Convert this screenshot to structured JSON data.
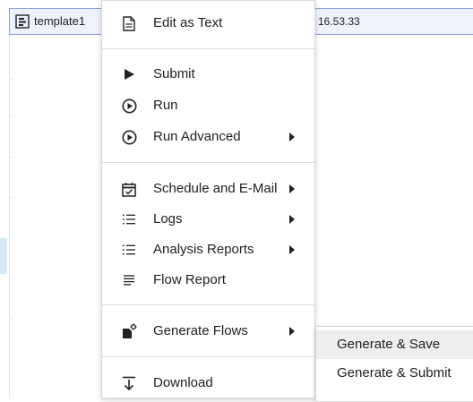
{
  "tab": {
    "label": "template1",
    "icon": "flow-template-icon",
    "time_fragment": "16.53.33"
  },
  "menu": {
    "edit_as_text": "Edit as Text",
    "submit": "Submit",
    "run": "Run",
    "run_advanced": "Run Advanced",
    "schedule_email": "Schedule and E-Mail",
    "logs": "Logs",
    "analysis_reports": "Analysis Reports",
    "flow_report": "Flow Report",
    "generate_flows": "Generate Flows",
    "download": "Download"
  },
  "submenu": {
    "generate_save": "Generate & Save",
    "generate_submit": "Generate & Submit"
  },
  "colors": {
    "tab_background": "#eef2fb",
    "tab_border": "#8ea5d6",
    "submenu_highlight": "#eeeeee"
  }
}
